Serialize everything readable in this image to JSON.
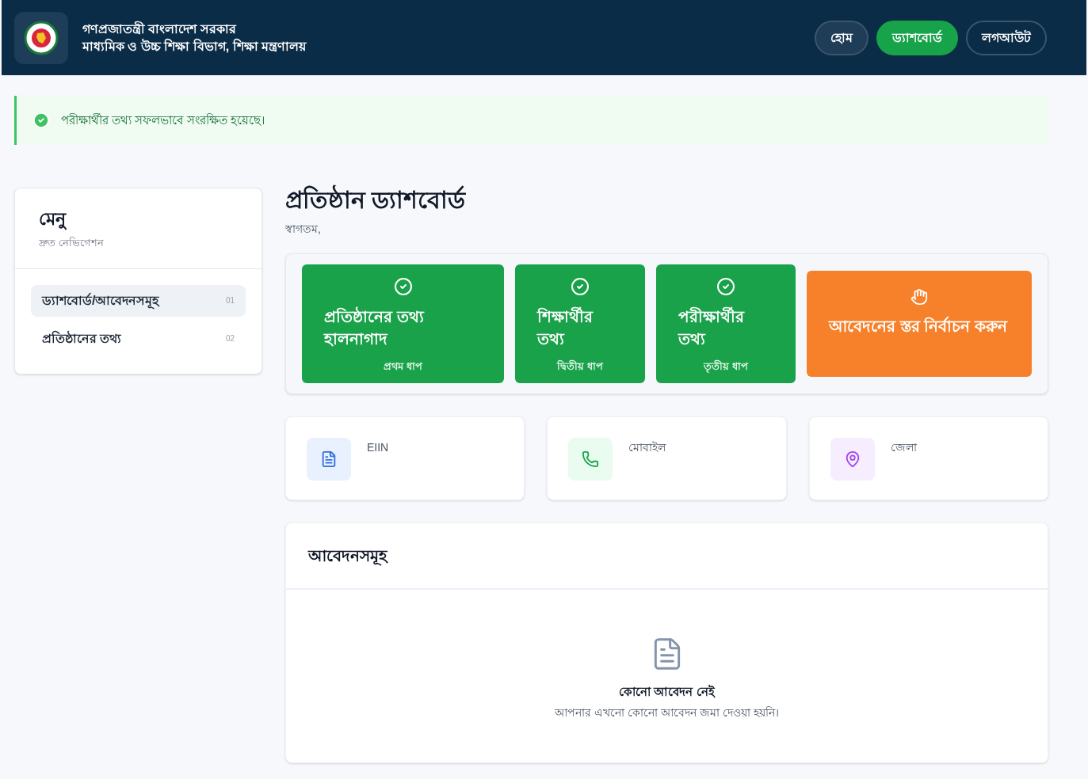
{
  "header": {
    "title_line1": "গণপ্রজাতন্ত্রী বাংলাদেশ সরকার",
    "title_line2": "মাধ্যমিক ও উচ্চ শিক্ষা বিভাগ, শিক্ষা মন্ত্রণালয়",
    "nav": [
      {
        "label": "হোম",
        "selected": false
      },
      {
        "label": "ড্যাশবোর্ড",
        "selected": true
      },
      {
        "label": "লগআউট",
        "selected": false
      }
    ]
  },
  "alert": {
    "kind": "success",
    "message": "পরীক্ষার্থীর তথ্য সফলভাবে সংরক্ষিত হয়েছে।"
  },
  "sidebar": {
    "title": "মেনু",
    "subtitle": "দ্রুত নেভিগেশন",
    "items": [
      {
        "label": "ড্যাশবোর্ড/আবেদনসমূহ",
        "number": "01",
        "selected": true
      },
      {
        "label": "প্রতিষ্ঠানের তথ্য",
        "number": "02",
        "selected": false
      }
    ]
  },
  "page": {
    "title": "প্রতিষ্ঠান ড্যাশবোর্ড",
    "welcome": "স্বাগতম,"
  },
  "steps": [
    {
      "kind": "done",
      "title": "প্রতিষ্ঠানের তথ্য হালনাগাদ",
      "caption": "প্রথম ধাপ"
    },
    {
      "kind": "done",
      "title": "শিক্ষার্থীর তথ্য",
      "caption": "দ্বিতীয় ধাপ"
    },
    {
      "kind": "done",
      "title": "পরীক্ষার্থীর তথ্য",
      "caption": "তৃতীয় ধাপ"
    },
    {
      "kind": "current",
      "title": "আবেদনের স্তর নির্বাচন করুন"
    }
  ],
  "info_cards": [
    {
      "kind": "document",
      "label": "EIIN"
    },
    {
      "kind": "phone",
      "label": "মোবাইল"
    },
    {
      "kind": "location",
      "label": "জেলা"
    }
  ],
  "applications": {
    "title": "আবেদনসমূহ",
    "empty_title": "কোনো আবেদন নেই",
    "empty_message": "আপনার এখনো কোনো আবেদন জমা দেওয়া হয়নি।"
  }
}
